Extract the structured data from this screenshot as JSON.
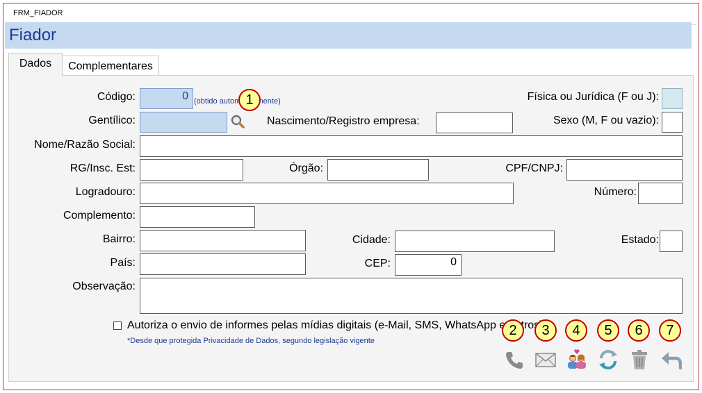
{
  "window": {
    "title": "FRM_FIADOR"
  },
  "header": {
    "title": "Fiador"
  },
  "tabs": [
    {
      "label": "Dados"
    },
    {
      "label": "Complementares"
    }
  ],
  "form": {
    "codigo": {
      "label": "Código:",
      "value": "0",
      "note": "(obtido automaticamente)"
    },
    "fisica_juridica": {
      "label": "Física ou Jurídica (F ou J):",
      "value": ""
    },
    "gentilico": {
      "label": "Gentílico:",
      "value": ""
    },
    "nascimento": {
      "label": "Nascimento/Registro empresa:",
      "value": ""
    },
    "sexo": {
      "label": "Sexo (M, F ou vazio):",
      "value": ""
    },
    "nome": {
      "label": "Nome/Razão Social:",
      "value": ""
    },
    "rg": {
      "label": "RG/Insc. Est:",
      "value": ""
    },
    "orgao": {
      "label": "Órgão:",
      "value": ""
    },
    "cpf": {
      "label": "CPF/CNPJ:",
      "value": ""
    },
    "logradouro": {
      "label": "Logradouro:",
      "value": ""
    },
    "numero": {
      "label": "Número:",
      "value": ""
    },
    "complemento": {
      "label": "Complemento:",
      "value": ""
    },
    "bairro": {
      "label": "Bairro:",
      "value": ""
    },
    "cidade": {
      "label": "Cidade:",
      "value": ""
    },
    "estado": {
      "label": "Estado:",
      "value": ""
    },
    "pais": {
      "label": "País:",
      "value": ""
    },
    "cep": {
      "label": "CEP:",
      "value": "0"
    },
    "observacao": {
      "label": "Observação:",
      "value": ""
    },
    "autoriza": {
      "label": "Autoriza o envio de informes pelas mídias digitais (e-Mail, SMS, WhatsApp e outros)",
      "note": "*Desde que protegida Privacidade de Dados, segundo legislação vigente",
      "checked": false
    }
  },
  "badges": [
    "1",
    "2",
    "3",
    "4",
    "5",
    "6",
    "7"
  ],
  "actions": [
    {
      "icon": "phone-icon"
    },
    {
      "icon": "envelope-icon"
    },
    {
      "icon": "people-icon"
    },
    {
      "icon": "refresh-icon"
    },
    {
      "icon": "trash-icon"
    },
    {
      "icon": "undo-icon"
    }
  ],
  "colors": {
    "header_bg": "#c5d9f1",
    "title": "#1f3a93",
    "border": "#b03a52",
    "badge_fill": "#ffff99",
    "badge_border": "#c00000"
  }
}
